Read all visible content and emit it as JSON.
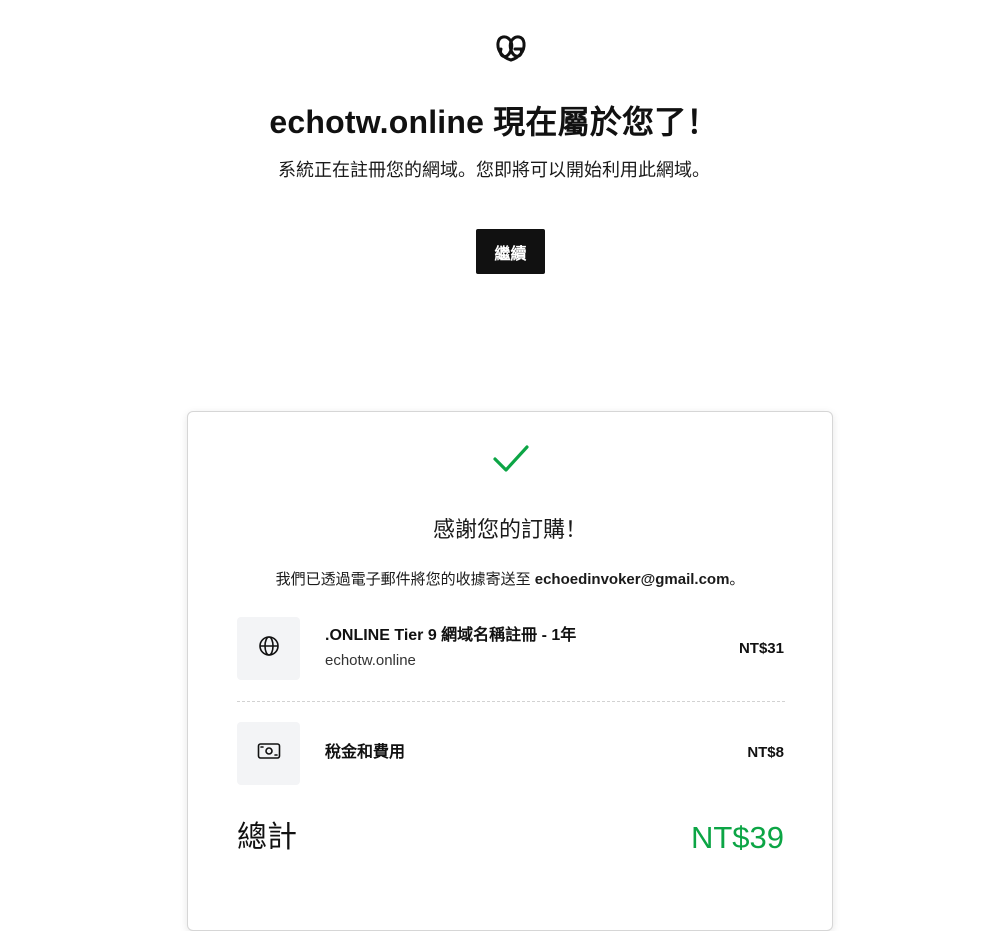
{
  "header": {
    "logo_icon": "godaddy-logo",
    "headline": "echotw.online 現在屬於您了！",
    "subline": "系統正在註冊您的網域。您即將可以開始利用此網域。",
    "continue_label": "繼續"
  },
  "receipt": {
    "check_icon": "checkmark-icon",
    "thanks": "感謝您的訂購！",
    "email_prefix": "我們已透過電子郵件將您的收據寄送至 ",
    "email": "echoedinvoker@gmail.com",
    "email_suffix": "。",
    "items": [
      {
        "icon": "globe-icon",
        "title": ".ONLINE Tier 9 網域名稱註冊 - 1年",
        "subtitle": "echotw.online",
        "price": "NT$31"
      },
      {
        "icon": "money-icon",
        "title": "稅金和費用",
        "subtitle": "",
        "price": "NT$8"
      }
    ],
    "total_label": "總計",
    "total_value": "NT$39"
  },
  "colors": {
    "accent_green": "#0ca545",
    "button_bg": "#111111"
  }
}
